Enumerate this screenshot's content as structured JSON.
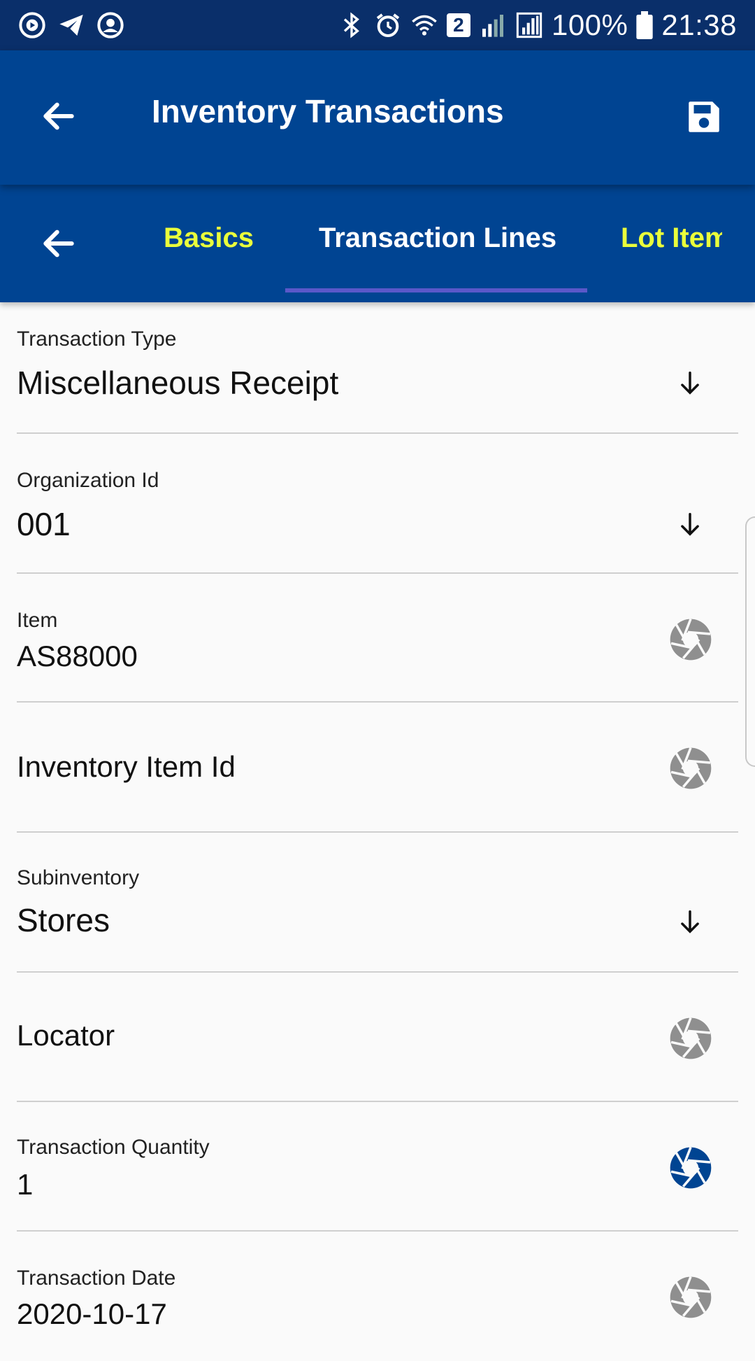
{
  "status_bar": {
    "battery": "100%",
    "time": "21:38",
    "sim_badge": "2",
    "icons": [
      "play-circle-icon",
      "telegram-icon",
      "account-icon",
      "bluetooth-icon",
      "alarm-icon",
      "wifi-icon",
      "signal-icon",
      "battery-icon"
    ]
  },
  "app_bar": {
    "title": "Inventory Transactions",
    "back_icon": "arrow-left-icon",
    "save_icon": "save-icon"
  },
  "tabs": {
    "items": [
      {
        "label": "Basics",
        "selected": false
      },
      {
        "label": "Transaction Lines",
        "selected": true
      },
      {
        "label": "Lot Item",
        "selected": false
      }
    ],
    "active_color": "#ffffff",
    "inactive_color": "#eaff3b",
    "indicator_color": "#5a58c9"
  },
  "fields": [
    {
      "label": "Transaction Type",
      "value": "Miscellaneous Receipt",
      "trail": "arrow-down-icon"
    },
    {
      "label": "Organization Id",
      "value": "001",
      "trail": "arrow-down-icon"
    },
    {
      "label": "Item",
      "value": "AS88000",
      "trail": "aperture-icon"
    },
    {
      "label": "",
      "value": "Inventory Item Id",
      "trail": "aperture-icon"
    },
    {
      "label": "Subinventory",
      "value": "Stores",
      "trail": "arrow-down-icon"
    },
    {
      "label": "",
      "value": "Locator",
      "trail": "aperture-icon"
    },
    {
      "label": "Transaction Quantity",
      "value": "1",
      "trail": "aperture-icon-active"
    },
    {
      "label": "Transaction Date",
      "value": "2020-10-17",
      "trail": "aperture-icon"
    }
  ],
  "colors": {
    "status_bar": "#0a2f6a",
    "app_bar": "#004492",
    "background": "#fafafa",
    "aperture_inactive": "#8f8f8f",
    "aperture_active": "#004492"
  }
}
